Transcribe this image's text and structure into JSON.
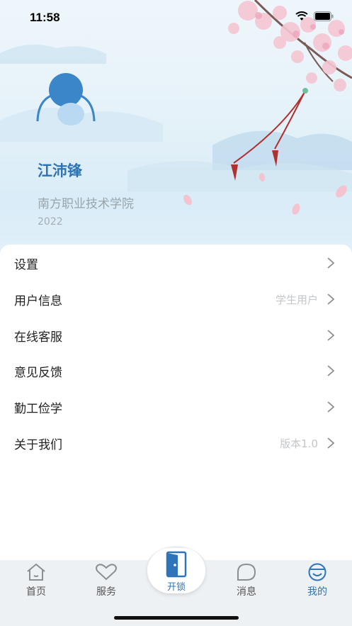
{
  "status_bar": {
    "time": "11:58"
  },
  "profile": {
    "name": "江沛锋",
    "school": "南方职业技术学院",
    "year": "2022"
  },
  "menu": [
    {
      "label": "设置",
      "value": ""
    },
    {
      "label": "用户信息",
      "value": "学生用户"
    },
    {
      "label": "在线客服",
      "value": ""
    },
    {
      "label": "意见反馈",
      "value": ""
    },
    {
      "label": "勤工俭学",
      "value": ""
    },
    {
      "label": "关于我们",
      "value": "版本1.0"
    }
  ],
  "tabbar": {
    "home": "首页",
    "service": "服务",
    "unlock": "开锁",
    "messages": "消息",
    "mine": "我的"
  },
  "colors": {
    "accent": "#2d74b8",
    "avatar_dark": "#3a86c8",
    "avatar_light": "#b9d9f2",
    "tab_bg": "#eef1f4"
  },
  "icons": [
    "home-icon",
    "heart-icon",
    "door-icon",
    "chat-bubble-icon",
    "smile-face-icon",
    "chevron-right-icon",
    "wifi-icon",
    "battery-icon"
  ]
}
